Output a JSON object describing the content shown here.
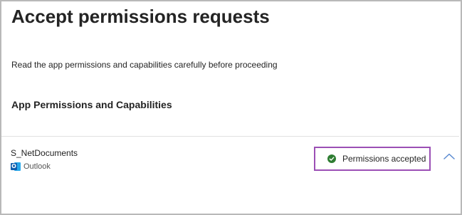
{
  "header": {
    "title": "Accept permissions requests"
  },
  "description": "Read the app permissions and capabilities carefully before proceeding",
  "section": {
    "title": "App Permissions and Capabilities"
  },
  "app": {
    "name": "S_NetDocuments",
    "host": "Outlook",
    "host_icon": "outlook-icon",
    "status": "Permissions accepted",
    "status_icon": "check-circle-icon",
    "expand_icon": "chevron-up-icon"
  },
  "colors": {
    "highlight_border": "#9b4fb5",
    "status_green": "#2e7d32",
    "chevron": "#5b8bd1"
  }
}
